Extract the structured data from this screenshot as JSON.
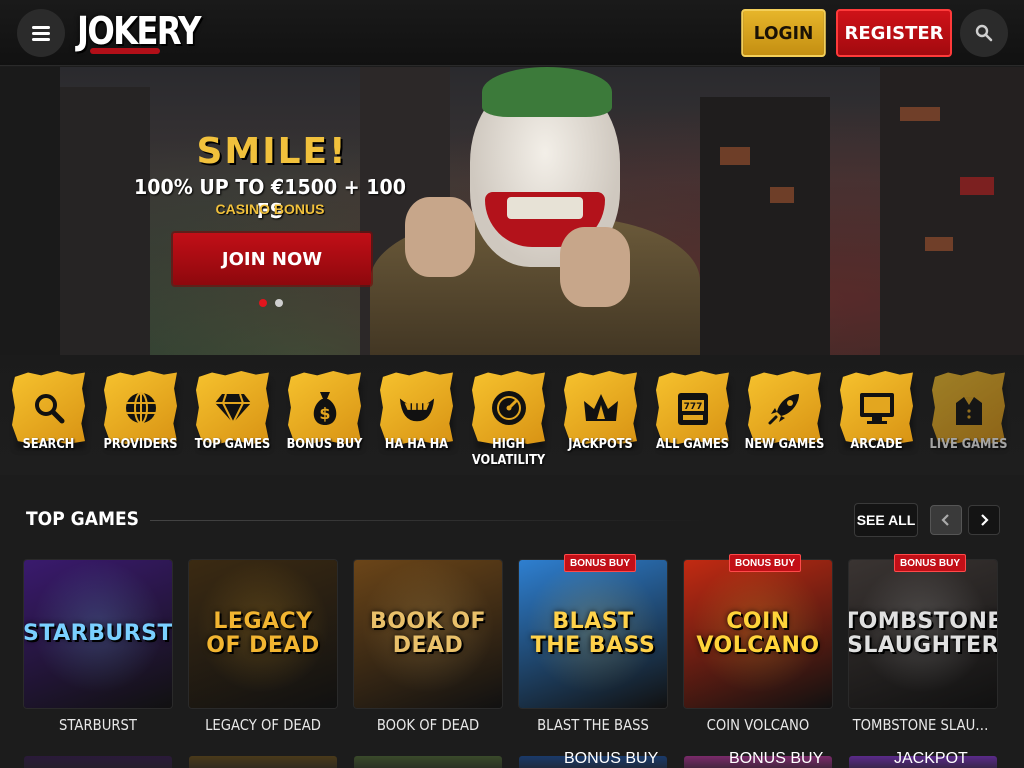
{
  "header": {
    "logo_text": "JOKERY",
    "login_label": "LOGIN",
    "register_label": "REGISTER",
    "menu_icon": "hamburger-icon",
    "search_icon": "search-icon"
  },
  "hero": {
    "title": "SMILE!",
    "offer": "100% UP TO €1500 + 100 FS",
    "subtitle": "CASINO BONUS",
    "cta_label": "JOIN NOW",
    "slides": 2,
    "active_slide": 1
  },
  "categories": [
    {
      "label": "SEARCH",
      "icon": "search-icon"
    },
    {
      "label": "PROVIDERS",
      "icon": "globe-icon"
    },
    {
      "label": "TOP GAMES",
      "icon": "diamond-icon"
    },
    {
      "label": "BONUS BUY",
      "icon": "money-bag-icon"
    },
    {
      "label": "HA HA HA",
      "icon": "grin-icon"
    },
    {
      "label": "HIGH VOLATILITY",
      "icon": "dial-icon"
    },
    {
      "label": "JACKPOTS",
      "icon": "crown-icon"
    },
    {
      "label": "ALL GAMES",
      "icon": "slot-machine-icon"
    },
    {
      "label": "NEW GAMES",
      "icon": "rocket-icon"
    },
    {
      "label": "ARCADE",
      "icon": "monitor-icon"
    },
    {
      "label": "LIVE GAMES",
      "icon": "dealer-icon"
    }
  ],
  "top_games": {
    "title": "TOP GAMES",
    "see_all_label": "SEE ALL",
    "prev_icon": "chevron-left-icon",
    "next_icon": "chevron-right-icon",
    "items": [
      {
        "name": "STARBURST",
        "art": "STARBURST",
        "badge": "",
        "bg": "#3a1a6e",
        "fg": "#7ad0ff"
      },
      {
        "name": "LEGACY OF DEAD",
        "art": "LEGACY OF DEAD",
        "badge": "",
        "bg": "#3b2a12",
        "fg": "#f2b531"
      },
      {
        "name": "BOOK OF DEAD",
        "art": "BOOK OF DEAD",
        "badge": "",
        "bg": "#6b4518",
        "fg": "#e9c06a"
      },
      {
        "name": "BLAST THE BASS",
        "art": "BLAST THE BASS",
        "badge": "BONUS BUY",
        "bg": "#2e7fd0",
        "fg": "#ffd24a"
      },
      {
        "name": "COIN VOLCANO",
        "art": "COIN VOLCANO",
        "badge": "BONUS BUY",
        "bg": "#c22a12",
        "fg": "#ffd43a"
      },
      {
        "name": "TOMBSTONE SLAUGH...",
        "art": "TOMBSTONE SLAUGHTER",
        "badge": "BONUS BUY",
        "bg": "#3a3432",
        "fg": "#e0e0e0"
      }
    ],
    "row2_badges": [
      "",
      "",
      "",
      "BONUS BUY",
      "BONUS BUY",
      "JACKPOT"
    ]
  },
  "colors": {
    "gold": "#f1c13c",
    "red": "#c20f17",
    "bg": "#1c1c1c"
  }
}
